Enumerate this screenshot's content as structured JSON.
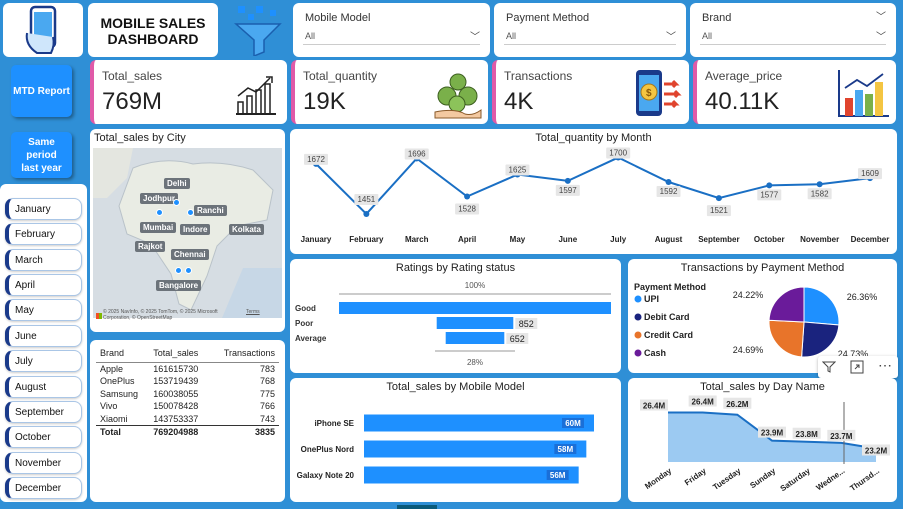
{
  "header": {
    "title_line1": "MOBILE SALES",
    "title_line2": "DASHBOARD"
  },
  "slicers": [
    {
      "label": "Mobile Model",
      "value": "All"
    },
    {
      "label": "Payment Method",
      "value": "All"
    },
    {
      "label": "Brand",
      "value": "All"
    }
  ],
  "kpis": [
    {
      "label": "Total_sales",
      "value": "769M"
    },
    {
      "label": "Total_quantity",
      "value": "19K"
    },
    {
      "label": "Transactions",
      "value": "4K"
    },
    {
      "label": "Average_price",
      "value": "40.11K"
    }
  ],
  "sidebar": {
    "mtd_button": "MTD Report",
    "spl_button": "Same period last year",
    "months": [
      "January",
      "February",
      "March",
      "April",
      "May",
      "June",
      "July",
      "August",
      "September",
      "October",
      "November",
      "December"
    ]
  },
  "map": {
    "title": "Total_sales by City",
    "cities": [
      "Delhi",
      "Jodhpur",
      "Ranchi",
      "Mumbai",
      "Indore",
      "Kolkata",
      "Rajkot",
      "Chennai",
      "Bangalore"
    ],
    "attribution": "© 2025 NavInfo, © 2025 TomTom, © 2025 Microsoft Corporation, © OpenStreetMap",
    "terms": "Terms"
  },
  "brand_table": {
    "headers": [
      "Brand",
      "Total_sales",
      "Transactions"
    ],
    "rows": [
      [
        "Apple",
        "161615730",
        "783"
      ],
      [
        "OnePlus",
        "153719439",
        "768"
      ],
      [
        "Samsung",
        "160038055",
        "775"
      ],
      [
        "Vivo",
        "150078428",
        "766"
      ],
      [
        "Xiaomi",
        "143753337",
        "743"
      ]
    ],
    "total": [
      "Total",
      "769204988",
      "3835"
    ]
  },
  "colors": {
    "background": "#2f8fd6",
    "accent": "#1e90ff",
    "kpi_border": "#e05aa8",
    "line": "#1a6fc4"
  },
  "chart_data": [
    {
      "type": "line",
      "title": "Total_quantity by Month",
      "categories": [
        "January",
        "February",
        "March",
        "April",
        "May",
        "June",
        "July",
        "August",
        "September",
        "October",
        "November",
        "December"
      ],
      "values": [
        1672,
        1451,
        1696,
        1528,
        1625,
        1597,
        1700,
        1592,
        1521,
        1577,
        1582,
        1609
      ]
    },
    {
      "type": "bar",
      "title": "Ratings by Rating status",
      "categories": [
        "Good",
        "Poor",
        "Average"
      ],
      "values": [
        3026,
        852,
        652
      ],
      "labels": [
        "",
        "852",
        "652"
      ],
      "annotations": [
        "100%",
        "28%"
      ]
    },
    {
      "type": "pie",
      "title": "Transactions by Payment Method",
      "legend_title": "Payment Method",
      "categories": [
        "UPI",
        "Debit Card",
        "Credit Card",
        "Cash"
      ],
      "values": [
        26.36,
        24.73,
        24.69,
        24.22
      ],
      "labels": [
        "26.36%",
        "24.73%",
        "24.69%",
        "24.22%"
      ],
      "series_colors": [
        "#1e90ff",
        "#1a237e",
        "#e8742a",
        "#6a1b9a"
      ]
    },
    {
      "type": "bar",
      "title": "Total_sales by Mobile Model",
      "categories": [
        "iPhone SE",
        "OnePlus Nord",
        "Galaxy Note 20"
      ],
      "values": [
        60,
        58,
        56
      ],
      "labels": [
        "60M",
        "58M",
        "56M"
      ]
    },
    {
      "type": "area",
      "title": "Total_sales by Day Name",
      "categories": [
        "Monday",
        "Friday",
        "Tuesday",
        "Sunday",
        "Saturday",
        "Wedne...",
        "Thursd..."
      ],
      "values": [
        26.4,
        26.4,
        26.2,
        23.9,
        23.8,
        23.7,
        23.2
      ],
      "labels": [
        "26.4M",
        "26.4M",
        "26.2M",
        "23.9M",
        "23.8M",
        "23.7M",
        "23.2M"
      ]
    }
  ]
}
